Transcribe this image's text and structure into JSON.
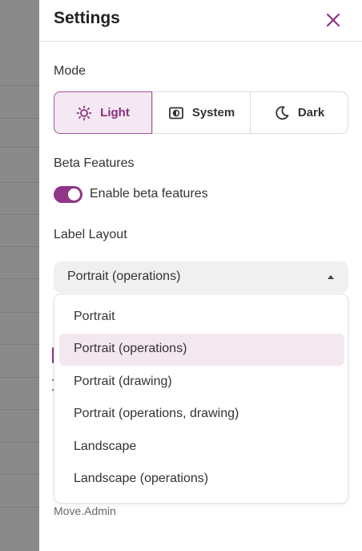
{
  "panel": {
    "title": "Settings"
  },
  "mode": {
    "label": "Mode",
    "options": [
      {
        "label": "Light",
        "icon": "sun-icon",
        "active": true
      },
      {
        "label": "System",
        "icon": "system-icon",
        "active": false
      },
      {
        "label": "Dark",
        "icon": "moon-icon",
        "active": false
      }
    ]
  },
  "beta": {
    "label": "Beta Features",
    "toggle_label": "Enable beta features",
    "enabled": true
  },
  "label_layout": {
    "label": "Label Layout",
    "selected": "Portrait (operations)",
    "options": [
      "Portrait",
      "Portrait (operations)",
      "Portrait (drawing)",
      "Portrait (operations, drawing)",
      "Landscape",
      "Landscape (operations)"
    ]
  },
  "footer": {
    "text": "Move.Admin"
  },
  "colors": {
    "accent": "#8f3686",
    "accent_bg": "#f4e8f2",
    "backdrop": "#8a8a8a"
  }
}
